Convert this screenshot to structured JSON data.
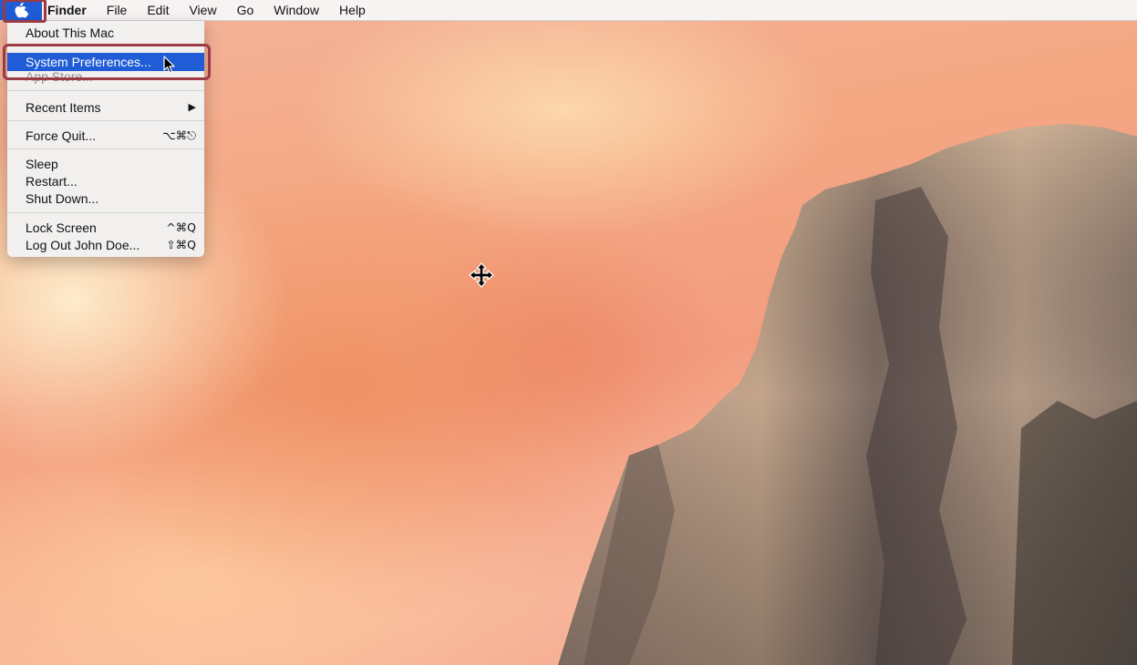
{
  "menubar": {
    "apple_icon": "apple-icon",
    "app_name": "Finder",
    "menus": [
      "File",
      "Edit",
      "View",
      "Go",
      "Window",
      "Help"
    ]
  },
  "apple_menu": {
    "about": "About This Mac",
    "system_preferences": "System Preferences...",
    "app_store": "App Store...",
    "recent_items": "Recent Items",
    "recent_items_arrow": "▶",
    "force_quit": "Force Quit...",
    "force_quit_shortcut": "⌥⌘⎋",
    "sleep": "Sleep",
    "restart": "Restart...",
    "shut_down": "Shut Down...",
    "lock_screen": "Lock Screen",
    "lock_screen_shortcut": "^⌘Q",
    "log_out": "Log Out John Doe...",
    "log_out_shortcut": "⇧⌘Q"
  },
  "colors": {
    "selection": "#1f5cd6",
    "annotation": "#9b3a45"
  },
  "icons": {
    "pointer": "arrow-cursor-icon",
    "move": "move-cursor-icon"
  }
}
